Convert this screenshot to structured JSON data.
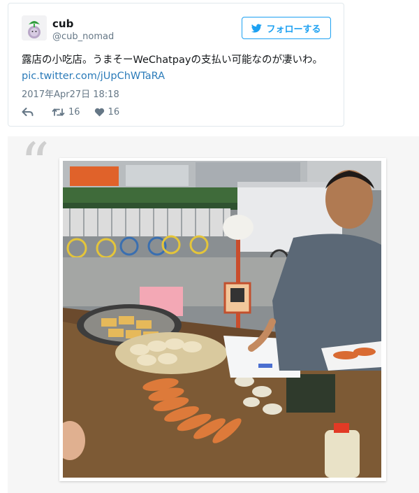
{
  "tweet": {
    "display_name": "cub",
    "handle": "@cub_nomad",
    "follow_label": "フォローする",
    "text": "露店の小吃店。うまそーWeChatpayの支払い可能なのが凄いわ。",
    "link": "pic.twitter.com/jUpChWTaRA",
    "timestamp": "2017年Apr27日 18:18",
    "retweet_count": "16",
    "like_count": "16"
  },
  "quote": {
    "mark": "“"
  },
  "colors": {
    "twitter_blue": "#1da1f2",
    "link_blue": "#2b7bb9",
    "muted_gray": "#657786"
  },
  "icons": [
    "avatar-image",
    "twitter-bird-icon",
    "reply-icon",
    "retweet-icon",
    "heart-icon"
  ]
}
